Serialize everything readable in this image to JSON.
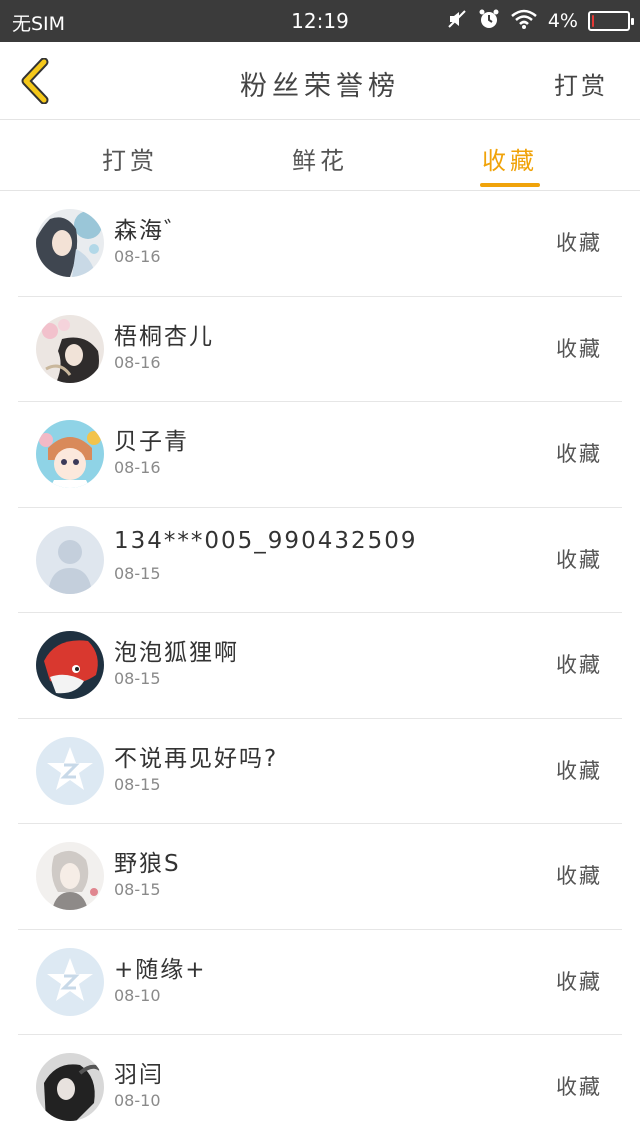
{
  "status_bar": {
    "carrier": "无SIM",
    "time": "12:19",
    "battery": "4%",
    "battery_level": 0.04,
    "icons": [
      "mute-icon",
      "alarm-icon",
      "wifi-icon",
      "battery-icon"
    ]
  },
  "header": {
    "back_icon": "chevron-left-icon",
    "title": "粉丝荣誉榜",
    "right_action": "打赏"
  },
  "tabs": [
    {
      "label": "打赏",
      "active": false
    },
    {
      "label": "鲜花",
      "active": false
    },
    {
      "label": "收藏",
      "active": true
    }
  ],
  "colors": {
    "accent": "#f0a30a",
    "status_bar_bg": "#3b3b3b",
    "divider": "#e6e6e6"
  },
  "fans": [
    {
      "name": "森海゛",
      "date": "08-16",
      "action": "收藏",
      "avatar": "anime-girl-avatar"
    },
    {
      "name": "梧桐杏儿",
      "date": "08-16",
      "action": "收藏",
      "avatar": "dark-haired-figure-avatar"
    },
    {
      "name": "贝子青",
      "date": "08-16",
      "action": "收藏",
      "avatar": "cartoon-girl-avatar"
    },
    {
      "name": "134***005_990432509",
      "date": "08-15",
      "action": "收藏",
      "avatar": "default-person-avatar"
    },
    {
      "name": "泡泡狐狸啊",
      "date": "08-15",
      "action": "收藏",
      "avatar": "red-fox-avatar"
    },
    {
      "name": "不说再见好吗?",
      "date": "08-15",
      "action": "收藏",
      "avatar": "qq-star-avatar"
    },
    {
      "name": "野狼S",
      "date": "08-15",
      "action": "收藏",
      "avatar": "sketch-figure-avatar"
    },
    {
      "name": "+随缘+",
      "date": "08-10",
      "action": "收藏",
      "avatar": "qq-star-avatar"
    },
    {
      "name": "羽闫",
      "date": "08-10",
      "action": "收藏",
      "avatar": "dark-figure-avatar"
    }
  ]
}
